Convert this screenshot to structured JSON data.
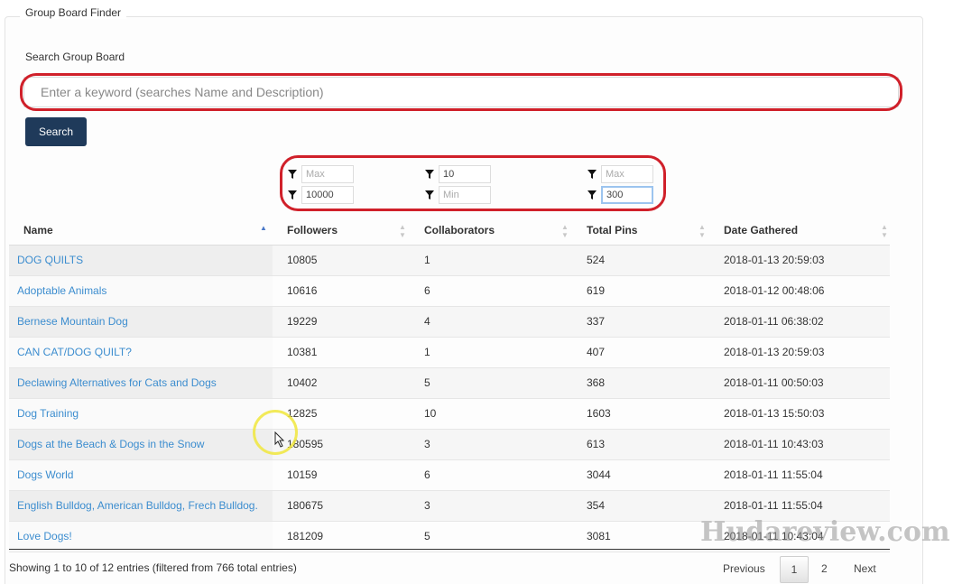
{
  "panel": {
    "legend": "Group Board Finder",
    "search_label": "Search Group Board",
    "search_placeholder": "Enter a keyword (searches Name and Description)",
    "search_button": "Search"
  },
  "filters": {
    "followers_max": {
      "value": "",
      "placeholder": "Max"
    },
    "followers_min": {
      "value": "10000",
      "placeholder": "Min"
    },
    "collaborators_max": {
      "value": "10",
      "placeholder": "Max"
    },
    "collaborators_min": {
      "value": "",
      "placeholder": "Min"
    },
    "pins_max": {
      "value": "",
      "placeholder": "Max"
    },
    "pins_min": {
      "value": "300",
      "placeholder": "Min"
    }
  },
  "table": {
    "columns": [
      "Name",
      "Followers",
      "Collaborators",
      "Total Pins",
      "Date Gathered"
    ],
    "sorted_column": "Name",
    "rows": [
      {
        "name": "DOG QUILTS",
        "followers": "10805",
        "collaborators": "1",
        "pins": "524",
        "date": "2018-01-13 20:59:03"
      },
      {
        "name": "Adoptable Animals",
        "followers": "10616",
        "collaborators": "6",
        "pins": "619",
        "date": "2018-01-12 00:48:06"
      },
      {
        "name": "Bernese Mountain Dog",
        "followers": "19229",
        "collaborators": "4",
        "pins": "337",
        "date": "2018-01-11 06:38:02"
      },
      {
        "name": "CAN CAT/DOG QUILT?",
        "followers": "10381",
        "collaborators": "1",
        "pins": "407",
        "date": "2018-01-13 20:59:03"
      },
      {
        "name": "Declawing Alternatives for Cats and Dogs",
        "followers": "10402",
        "collaborators": "5",
        "pins": "368",
        "date": "2018-01-11 00:50:03"
      },
      {
        "name": "Dog Training",
        "followers": "12825",
        "collaborators": "10",
        "pins": "1603",
        "date": "2018-01-13 15:50:03"
      },
      {
        "name": "Dogs at the Beach & Dogs in the Snow",
        "followers": "180595",
        "collaborators": "3",
        "pins": "613",
        "date": "2018-01-11 10:43:03"
      },
      {
        "name": "Dogs World",
        "followers": "10159",
        "collaborators": "6",
        "pins": "3044",
        "date": "2018-01-11 11:55:04"
      },
      {
        "name": "English Bulldog, American Bulldog, Frech Bulldog.",
        "followers": "180675",
        "collaborators": "3",
        "pins": "354",
        "date": "2018-01-11 11:55:04"
      },
      {
        "name": "Love Dogs!",
        "followers": "181209",
        "collaborators": "5",
        "pins": "3081",
        "date": "2018-01-11 10:43:04"
      }
    ]
  },
  "footer": {
    "info": "Showing 1 to 10 of 12 entries (filtered from 766 total entries)",
    "previous": "Previous",
    "page1": "1",
    "page2": "2",
    "next": "Next"
  },
  "watermark": "Hudareview.com",
  "colors": {
    "accent_button": "#1f3a5a",
    "link": "#3c8dcf",
    "annotation_red": "#d0202a"
  }
}
